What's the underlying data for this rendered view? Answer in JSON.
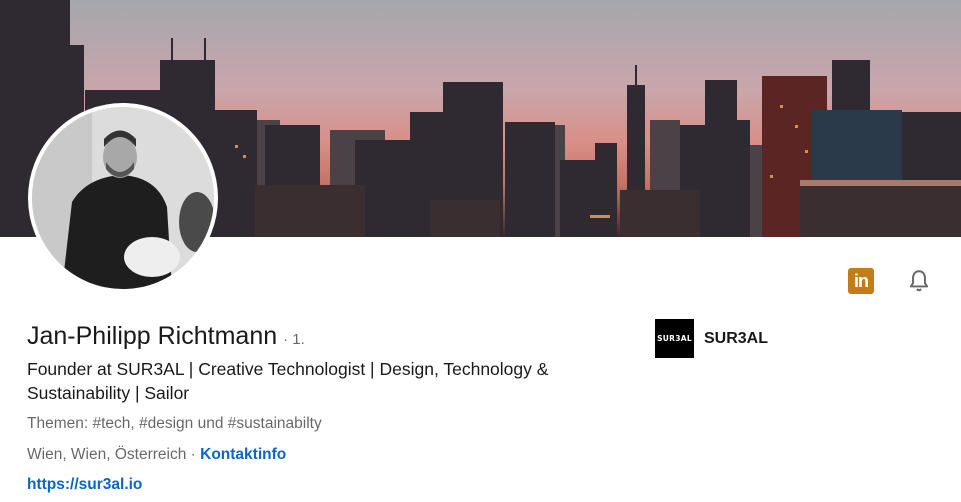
{
  "profile": {
    "name": "Jan-Philipp Richtmann",
    "connection_degree": "· 1.",
    "headline": "Founder at SUR3AL | Creative Technologist | Design, Technology & Sustainability | Sailor",
    "topics": "Themen: #tech, #design und #sustainabilty",
    "location": "Wien, Wien, Österreich",
    "location_separator": " · ",
    "contact_info_label": "Kontaktinfo",
    "website": "https://sur3al.io"
  },
  "company": {
    "name": "SUR3AL",
    "logo_text": "SUR3AL"
  },
  "actions": {
    "linkedin_icon": "linkedin-icon",
    "linkedin_label": "in",
    "bell_icon": "bell-icon"
  },
  "colors": {
    "link": "#0a66c2",
    "linkedin_badge": "#c37d16"
  }
}
